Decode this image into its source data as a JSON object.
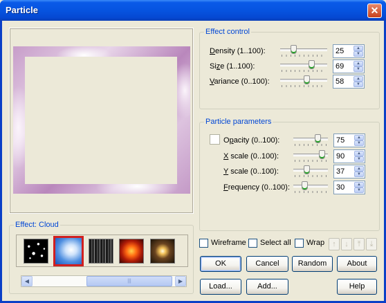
{
  "window": {
    "title": "Particle",
    "close_glyph": "✕"
  },
  "effect_control": {
    "title": "Effect control",
    "rows": [
      {
        "label_accel": "D",
        "label_rest": "ensity (1..100):",
        "value": "25",
        "level": 25
      },
      {
        "label_pre": "Si",
        "label_accel": "z",
        "label_rest": "e (1..100):",
        "value": "69",
        "level": 69
      },
      {
        "label_accel": "V",
        "label_rest": "ariance (0..100):",
        "value": "58",
        "level": 58
      }
    ]
  },
  "particle_parameters": {
    "title": "Particle parameters",
    "rows": [
      {
        "label_pre": "O",
        "label_accel": "p",
        "label_rest": "acity (0..100):",
        "value": "75",
        "level": 75
      },
      {
        "label_accel": "X",
        "label_rest": " scale (0..100):",
        "value": "90",
        "level": 90
      },
      {
        "label_accel": "Y",
        "label_rest": " scale (0..100):",
        "value": "37",
        "level": 37
      },
      {
        "label_accel": "F",
        "label_rest": "requency (0..100):",
        "value": "30",
        "level": 30
      }
    ]
  },
  "effect_group": {
    "title": "Effect: Cloud",
    "thumbnails": [
      "stars",
      "cloud",
      "rain",
      "fire",
      "sparkle"
    ],
    "selected": "cloud",
    "scroll_grip": "|||"
  },
  "options": {
    "wireframe": "Wireframe",
    "select_all": "Select all",
    "wrap": "Wrap"
  },
  "arrow_buttons": [
    "↑",
    "↓",
    "⤒",
    "⤓"
  ],
  "buttons": {
    "ok": "OK",
    "cancel": "Cancel",
    "random": "Random",
    "about": "About",
    "load": "Load...",
    "add": "Add...",
    "help": "Help"
  },
  "colors": {
    "group_title": "#0046d5",
    "title_bar": "#0654e0",
    "selected_thumb": "#d01f1f"
  }
}
